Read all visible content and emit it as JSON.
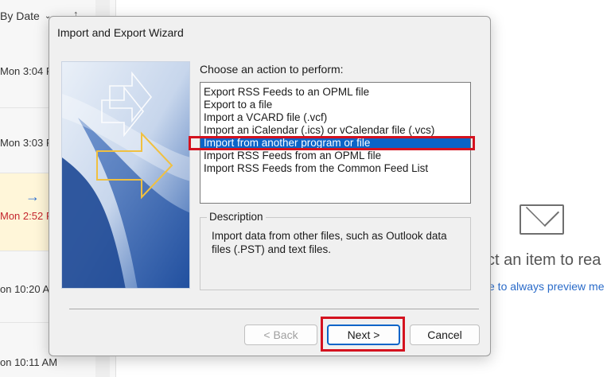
{
  "background": {
    "sort_label": "By Date",
    "messages": [
      {
        "time": "Mon 3:04 P"
      },
      {
        "time": "Mon 3:03 P"
      },
      {
        "time": "Mon 2:52 P"
      },
      {
        "time": "on 10:20 A"
      },
      {
        "time": "on 10:11 AM"
      }
    ],
    "reading_pane": {
      "select_text": "ct an item to rea",
      "preview_link": "e to always preview me"
    }
  },
  "dialog": {
    "title": "Import and Export Wizard",
    "prompt": "Choose an action to perform:",
    "actions": [
      "Export RSS Feeds to an OPML file",
      "Export to a file",
      "Import a VCARD file (.vcf)",
      "Import an iCalendar (.ics) or vCalendar file (.vcs)",
      "Import from another program or file",
      "Import RSS Feeds from an OPML file",
      "Import RSS Feeds from the Common Feed List"
    ],
    "selected_index": 4,
    "description_label": "Description",
    "description_text": "Import data from other files, such as Outlook data files (.PST) and text files.",
    "buttons": {
      "back": "< Back",
      "next": "Next >",
      "cancel": "Cancel"
    }
  },
  "colors": {
    "selection": "#0a64c8",
    "highlight_box": "#d4121f"
  }
}
